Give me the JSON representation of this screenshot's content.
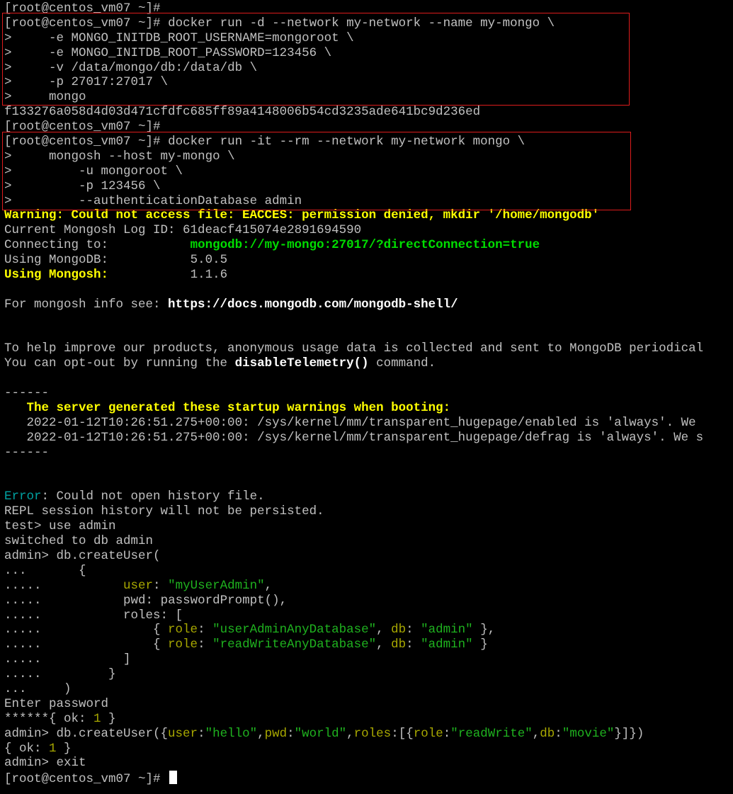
{
  "prompt": "[root@centos_vm07 ~]#",
  "cmd1": {
    "first": "docker run -d --network my-network --name my-mongo \\",
    "cont": [
      "-e MONGO_INITDB_ROOT_USERNAME=mongoroot \\",
      "-e MONGO_INITDB_ROOT_PASSWORD=123456 \\",
      "-v /data/mongo/db:/data/db \\",
      "-p 27017:27017 \\",
      "mongo"
    ]
  },
  "container_id": "f133276a058d4d03d471cfdfc685ff89a4148006b54cd3235ade641bc9d236ed",
  "cmd2": {
    "first": "docker run -it --rm --network my-network mongo \\",
    "cont": [
      "mongosh --host my-mongo \\",
      "-u mongoroot \\",
      "-p 123456 \\",
      "--authenticationDatabase admin"
    ]
  },
  "continuation_marker": ">",
  "warning_line": "Warning: Could not access file: EACCES: permission denied, mkdir '/home/mongodb'",
  "log_id": "Current Mongosh Log ID: 61deacf415074e2891694590",
  "connecting": {
    "label": "Connecting to:",
    "value": "mongodb://my-mongo:27017/?directConnection=true"
  },
  "using_mongodb": {
    "label": "Using MongoDB:",
    "value": "5.0.5"
  },
  "using_mongosh": {
    "label": "Using Mongosh:",
    "value": "1.1.6"
  },
  "info": {
    "prefix": "For mongosh info see: ",
    "url": "https://docs.mongodb.com/mongodb-shell/"
  },
  "telemetry1": "To help improve our products, anonymous usage data is collected and sent to MongoDB periodical",
  "telemetry2": {
    "prefix": "You can opt-out by running the ",
    "cmd": "disableTelemetry()",
    "suffix": " command."
  },
  "separator": "------",
  "startup_heading": "The server generated these startup warnings when booting:",
  "startup_lines": [
    "2022-01-12T10:26:51.275+00:00: /sys/kernel/mm/transparent_hugepage/enabled is 'always'. We",
    "2022-01-12T10:26:51.275+00:00: /sys/kernel/mm/transparent_hugepage/defrag is 'always'. We s"
  ],
  "history_error": {
    "label": "Error",
    "text": ": Could not open history file."
  },
  "repl_note": "REPL session history will not be persisted.",
  "use_cmd": "test> use admin",
  "switched": "switched to db admin",
  "create_user": {
    "line1": "admin> db.createUser(",
    "open_brace": "{",
    "user_key": "user",
    "user_val": "\"myUserAdmin\"",
    "pwd_key": "pwd",
    "pwd_val": "passwordPrompt(),",
    "roles_key": "roles",
    "roles_open": ": [",
    "role1": {
      "role": "\"userAdminAnyDatabase\"",
      "db": "\"admin\"",
      "tail": " },"
    },
    "role2": {
      "role": "\"readWriteAnyDatabase\"",
      "db": "\"admin\"",
      "tail": " }"
    },
    "roles_close": "]",
    "close_brace": "}",
    "close_paren": ")"
  },
  "enter_password": "Enter password",
  "ok_result1": {
    "prefix": "******{ ok: ",
    "num": "1",
    "suffix": " }"
  },
  "create_user2": {
    "prompt": "admin> db.createUser({",
    "user_key": "user",
    "user_val": "\"hello\"",
    "pwd_key": "pwd",
    "pwd_val": "\"world\"",
    "roles_key": "roles",
    "role_key": "role",
    "role_val": "\"readWrite\"",
    "db_key": "db",
    "db_val": "\"movie\"",
    "tail": "}]})"
  },
  "ok_result2": {
    "prefix": "{ ok: ",
    "num": "1",
    "suffix": " }"
  },
  "exit_cmd": "admin> exit",
  "colors": {
    "background": "#000000",
    "text": "#c0c0c0",
    "warning_yellow": "#ffff00",
    "url_green": "#00dd00",
    "string_green": "#1fb21f",
    "key_olive": "#a8a800",
    "error_teal": "#00a2a2",
    "highlight_red": "#dd1c1c"
  }
}
